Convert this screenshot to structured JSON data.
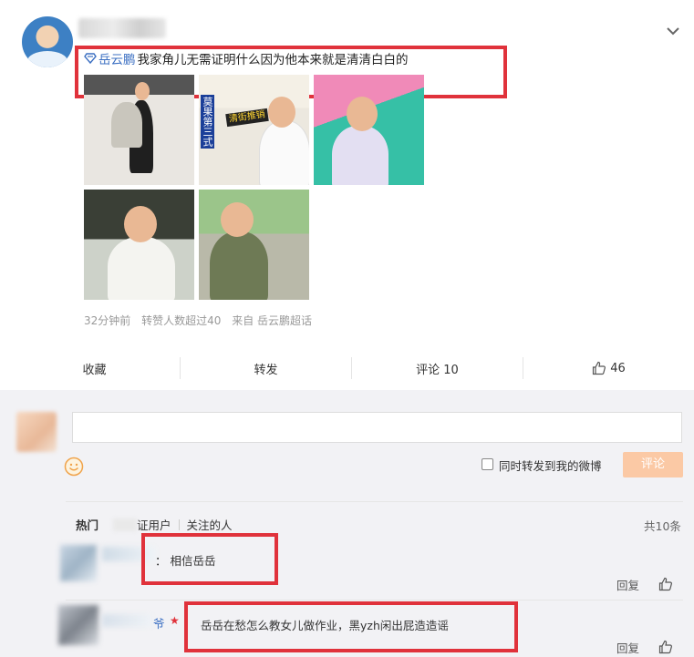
{
  "post": {
    "topic_tag": "岳云鹏",
    "text": "我家角儿无需证明什么因为他本来就是清清白白的",
    "meta": {
      "time": "32分钟前",
      "repost_note": "转赞人数超过40",
      "source": "来自 岳云鹏超话"
    },
    "image_signs": {
      "sign_blue": "莫果第三式",
      "sign_black": "清街推销"
    }
  },
  "actions": {
    "collect": "收藏",
    "repost": "转发",
    "comment": "评论 10",
    "like_count": "46"
  },
  "composer": {
    "input_value": "",
    "repost_checkbox_label": "同时转发到我的微博",
    "submit_label": "评论"
  },
  "filters": {
    "hot": "热门",
    "verified": "证用户",
    "following": "关注的人",
    "total": "共10条"
  },
  "comments": [
    {
      "text": "：  相信岳岳",
      "reply": "回复"
    },
    {
      "text": "岳岳在愁怎么教女儿做作业，黑yzh闲出屁造造谣",
      "name_fragment": "爷",
      "reply": "回复"
    }
  ],
  "colors": {
    "highlight_box": "#e0323b",
    "topic_blue": "#3b6fc2",
    "submit_disabled": "#fbc9a5"
  },
  "icons": {
    "expand": "chevron-down-icon",
    "topic": "diamond-icon",
    "like": "thumbs-up-icon",
    "emoji": "smiley-icon"
  }
}
